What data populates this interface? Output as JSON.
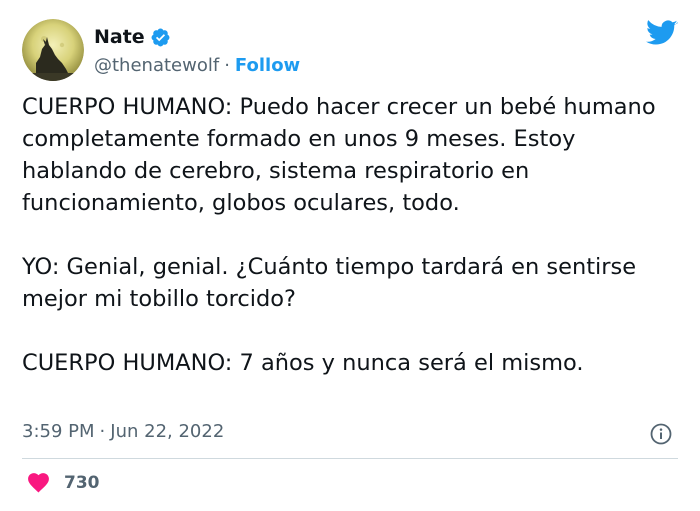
{
  "tweet": {
    "author": {
      "name": "Nate",
      "handle": "@thenatewolf",
      "follow_label": "Follow",
      "verified": true,
      "avatar_icon": "wolf-howling-moon-avatar"
    },
    "separator": "·",
    "paragraphs": [
      "CUERPO HUMANO: Puedo hacer crecer un bebé humano completamente formado en unos 9 meses. Estoy hablando de cerebro, sistema respiratorio en funcionamiento, globos oculares, todo.",
      "YO: Genial, genial. ¿Cuánto tiempo tardará en sentirse mejor mi tobillo torcido?",
      "CUERPO HUMANO: 7 años y nunca será el mismo."
    ],
    "time": "3:59 PM",
    "date": "Jun 22, 2022",
    "like_count": "730"
  },
  "icons": {
    "brand": "twitter-bird-icon",
    "verified": "verified-badge-icon",
    "info": "info-icon",
    "like": "heart-icon"
  },
  "colors": {
    "accent": "#1d9bf0",
    "text": "#0f1419",
    "secondary_text": "#536471",
    "heart": "#f91880",
    "divider": "#cfd9de"
  }
}
